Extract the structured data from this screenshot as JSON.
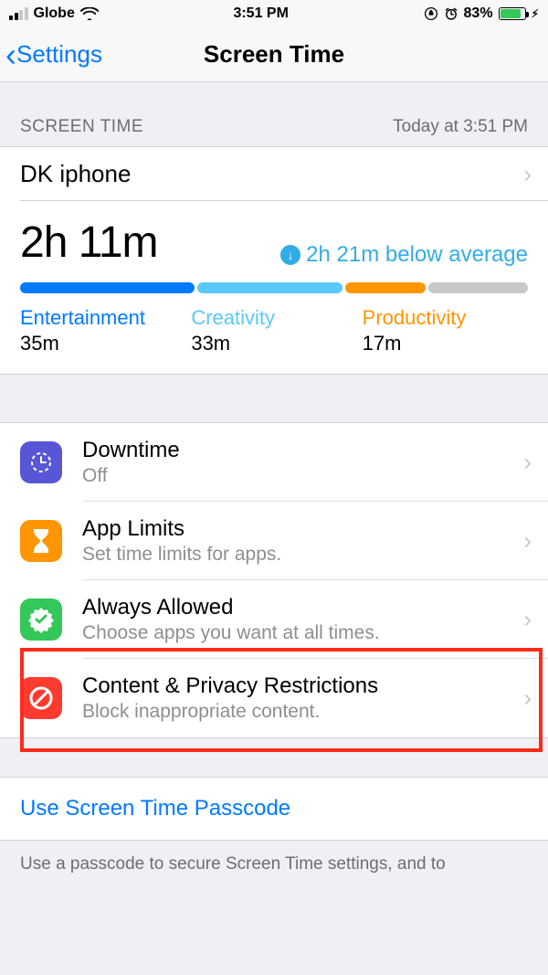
{
  "status": {
    "carrier": "Globe",
    "time": "3:51 PM",
    "battery_pct": "83%"
  },
  "nav": {
    "back_label": "Settings",
    "title": "Screen Time"
  },
  "section1": {
    "header_left": "SCREEN TIME",
    "header_right": "Today at 3:51 PM",
    "device_name": "DK iphone",
    "total_time": "2h 11m",
    "below_avg": "2h 21m below average",
    "categories": [
      {
        "label": "Entertainment",
        "time": "35m"
      },
      {
        "label": "Creativity",
        "time": "33m"
      },
      {
        "label": "Productivity",
        "time": "17m"
      }
    ]
  },
  "rows": {
    "downtime": {
      "title": "Downtime",
      "subtitle": "Off"
    },
    "applimits": {
      "title": "App Limits",
      "subtitle": "Set time limits for apps."
    },
    "always": {
      "title": "Always Allowed",
      "subtitle": "Choose apps you want at all times."
    },
    "content": {
      "title": "Content & Privacy Restrictions",
      "subtitle": "Block inappropriate content."
    }
  },
  "passcode": {
    "action": "Use Screen Time Passcode",
    "footer": "Use a passcode to secure Screen Time settings, and to"
  }
}
